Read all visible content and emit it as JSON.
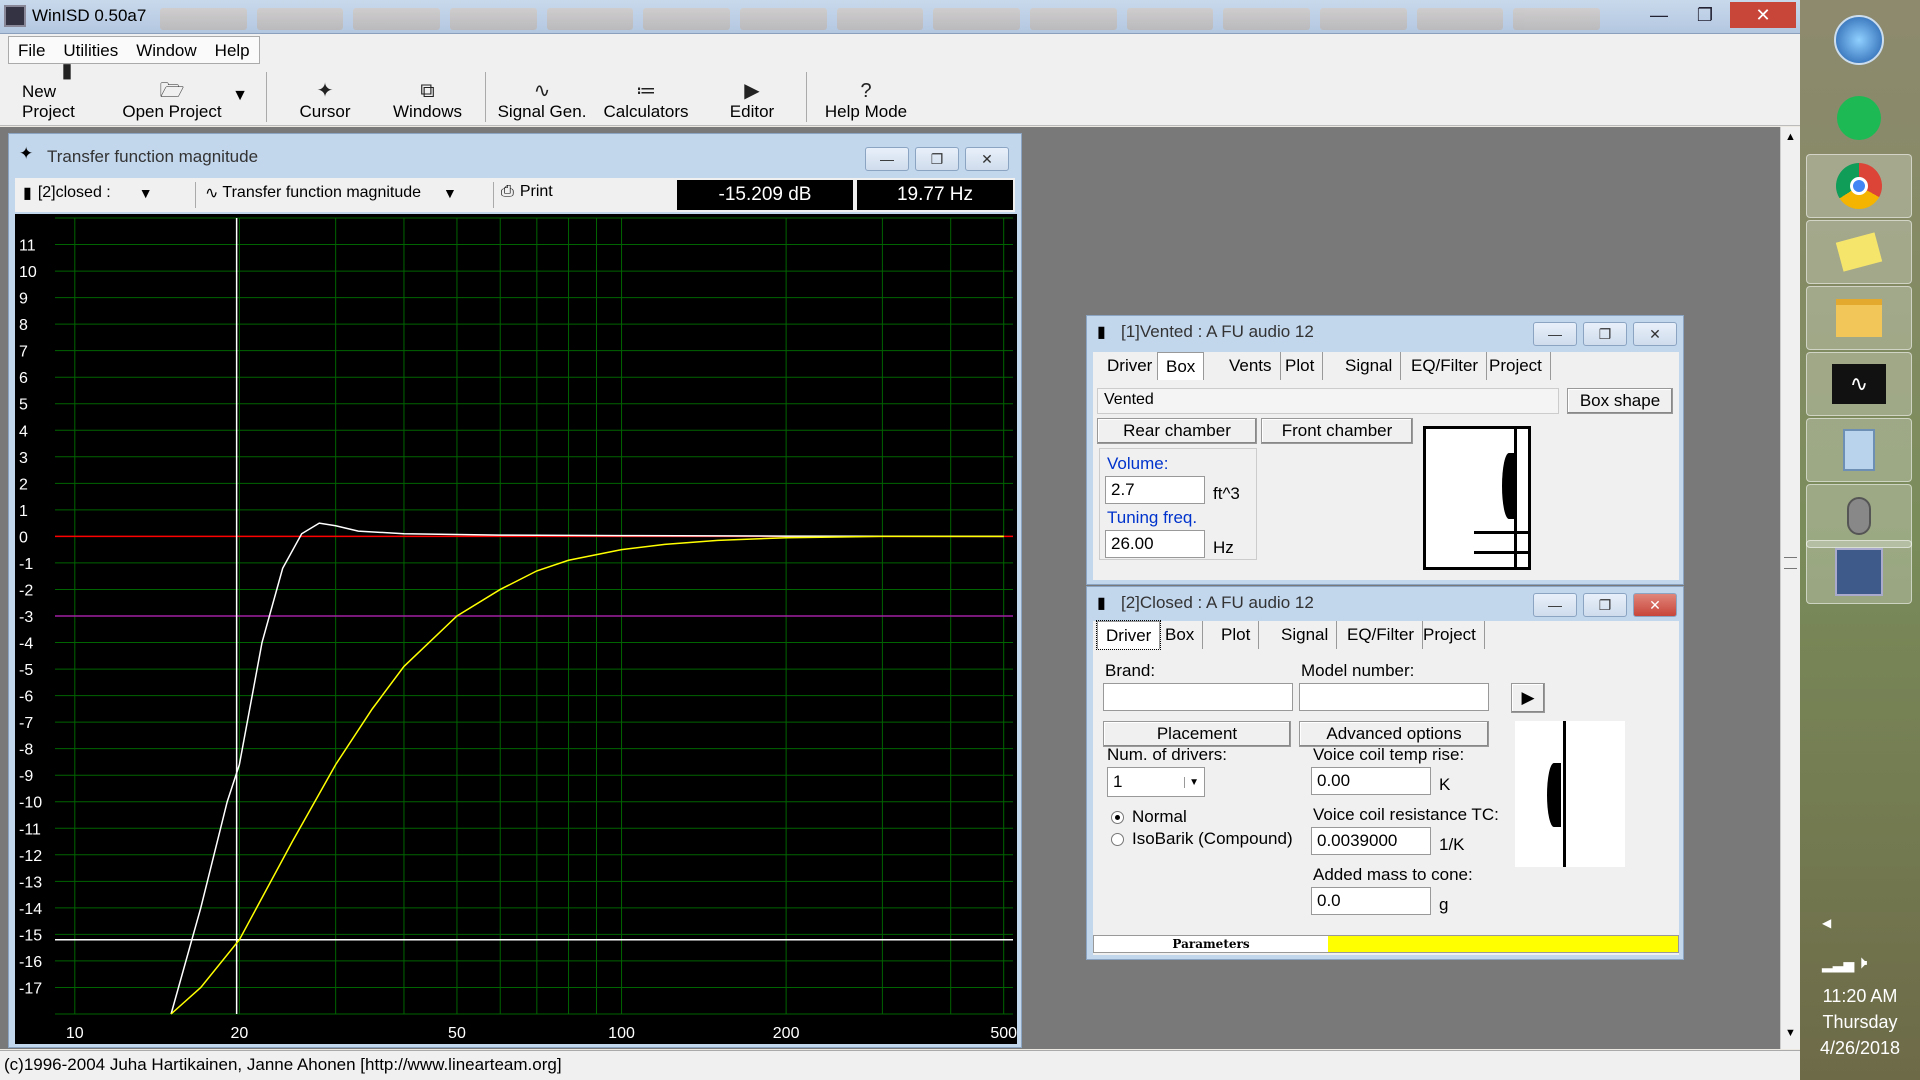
{
  "app": {
    "title": "WinISD 0.50a7"
  },
  "menu": [
    "File",
    "Utilities",
    "Window",
    "Help"
  ],
  "toolbar": {
    "new_project": "New Project",
    "open_project": "Open Project",
    "cursor": "Cursor",
    "windows": "Windows",
    "signal_gen": "Signal Gen.",
    "calculators": "Calculators",
    "editor": "Editor",
    "help_mode": "Help Mode"
  },
  "graph": {
    "title": "Transfer function magnitude",
    "project_select": "[2]closed :",
    "plot_select": "Transfer function magnitude",
    "print": "Print",
    "readout_db": "-15.209 dB",
    "readout_hz": "19.77 Hz",
    "y_ticks": [
      "11",
      "10",
      "9",
      "8",
      "7",
      "6",
      "5",
      "4",
      "3",
      "2",
      "1",
      "0",
      "-1",
      "-2",
      "-3",
      "-4",
      "-5",
      "-6",
      "-7",
      "-8",
      "-9",
      "-10",
      "-11",
      "-12",
      "-13",
      "-14",
      "-15",
      "-16",
      "-17"
    ],
    "x_ticks": [
      "10",
      "20",
      "50",
      "100",
      "200",
      "500"
    ],
    "colors": {
      "background": "#000000",
      "grid": "#006400",
      "zero_line": "#ff0000",
      "minus3_line": "#a020a0",
      "cursor": "#ffffff",
      "vented_curve": "#ffffff",
      "closed_curve": "#ffff00"
    }
  },
  "chart_data": {
    "type": "line",
    "title": "Transfer function magnitude",
    "xlabel": "",
    "ylabel": "",
    "xscale": "log",
    "xlim": [
      9.2,
      520
    ],
    "ylim": [
      -18,
      12
    ],
    "grid": true,
    "series": [
      {
        "x": [
          15,
          17,
          19,
          20,
          22,
          24,
          26,
          28,
          30,
          33,
          40,
          60,
          100,
          200,
          500
        ],
        "values": [
          -18,
          -14,
          -10,
          -8.6,
          -4,
          -1.2,
          0.1,
          0.5,
          0.4,
          0.2,
          0.1,
          0.05,
          0.03,
          0.01,
          0
        ]
      },
      {
        "x": [
          15,
          17,
          20,
          25,
          30,
          35,
          40,
          50,
          60,
          70,
          80,
          100,
          120,
          150,
          200,
          300,
          500
        ],
        "values": [
          -18,
          -17,
          -15.2,
          -11.5,
          -8.6,
          -6.5,
          -4.9,
          -3,
          -2,
          -1.3,
          -0.9,
          -0.5,
          -0.3,
          -0.15,
          -0.05,
          0,
          0
        ]
      }
    ],
    "hlines": [
      0,
      -3,
      -15.2
    ],
    "cursor_x": 19.77
  },
  "vented": {
    "title": "[1]Vented : A FU audio 12",
    "tabs": [
      "Driver",
      "Box",
      "Vents",
      "Plot",
      "Signal",
      "EQ/Filter",
      "Project"
    ],
    "box_type": "Vented",
    "box_shape": "Box shape",
    "rear_chamber": "Rear chamber",
    "front_chamber": "Front chamber",
    "volume_label": "Volume:",
    "volume": "2.7",
    "volume_unit": "ft^3",
    "tuning_label": "Tuning freq.",
    "tuning": "26.00",
    "tuning_unit": "Hz"
  },
  "closed": {
    "title": "[2]Closed : A FU audio 12",
    "tabs": [
      "Driver",
      "Box",
      "Plot",
      "Signal",
      "EQ/Filter",
      "Project"
    ],
    "brand_label": "Brand:",
    "brand": "",
    "model_label": "Model number:",
    "model": "",
    "placement": "Placement",
    "advanced": "Advanced options",
    "num_drivers_label": "Num. of drivers:",
    "num_drivers": "1",
    "normal": "Normal",
    "isobarik": "IsoBarik (Compound)",
    "vc_temp_label": "Voice coil temp rise:",
    "vc_temp": "0.00",
    "vc_temp_unit": "K",
    "vc_tc_label": "Voice coil resistance TC:",
    "vc_tc": "0.0039000",
    "vc_tc_unit": "1/K",
    "added_mass_label": "Added mass to cone:",
    "added_mass": "0.0",
    "added_mass_unit": "g",
    "parameters": "Parameters"
  },
  "status": {
    "text": "(c)1996-2004 Juha Hartikainen, Janne Ahonen [http://www.linearteam.org]"
  },
  "taskbar": {
    "time": "11:20 AM",
    "day": "Thursday",
    "date": "4/26/2018"
  }
}
